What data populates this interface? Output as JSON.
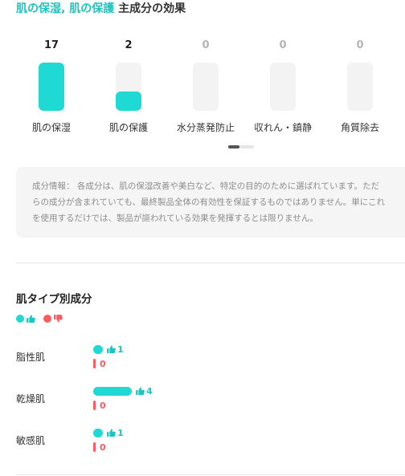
{
  "header": {
    "title_highlight": "肌の保湿, 肌の保護",
    "title_rest": " 主成分の効果"
  },
  "effects": [
    {
      "label": "肌の保湿",
      "count": "17",
      "fill": 1.0
    },
    {
      "label": "肌の保護",
      "count": "2",
      "fill": 0.4
    },
    {
      "label": "水分蒸発防止",
      "count": "0",
      "fill": 0
    },
    {
      "label": "収れん・鎮静",
      "count": "0",
      "fill": 0
    },
    {
      "label": "角質除去",
      "count": "0",
      "fill": 0
    }
  ],
  "info": {
    "line1": "成分情報： 各成分は、肌の保湿改善や美白など、特定の目的のために選ばれています。ただ",
    "line2": "らの成分が含まれていても、最終製品全体の有効性を保証するものではありません。単にこれ",
    "line3": "を使用するだけでは、製品が謳われている効果を発揮するとは限りません。"
  },
  "skin_section": {
    "title": "肌タイプ別成分",
    "rows": [
      {
        "name": "脂性肌",
        "good": "1",
        "bad": "0",
        "good_value": 1
      },
      {
        "name": "乾燥肌",
        "good": "4",
        "bad": "0",
        "good_value": 4
      },
      {
        "name": "敏感肌",
        "good": "1",
        "bad": "0",
        "good_value": 1
      }
    ]
  },
  "colors": {
    "accent": "#1ed9d4",
    "accent_text": "#18c6c2",
    "negative": "#ff5a5f",
    "track": "#f3f3f3"
  },
  "icons": {
    "good": "thumbs-up-icon",
    "bad": "thumbs-down-icon"
  }
}
